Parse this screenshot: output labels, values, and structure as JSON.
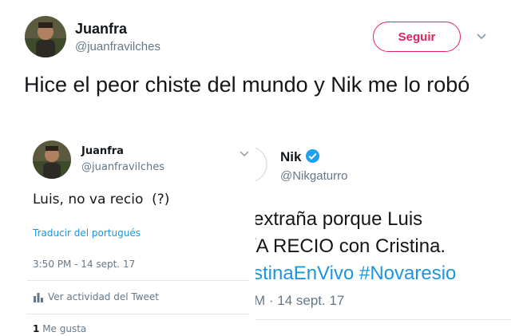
{
  "header": {
    "display_name": "Juanfra",
    "handle": "@juanfravilches",
    "follow_label": "Seguir",
    "menu_icon": "chevron-down-icon"
  },
  "tweet": {
    "text": "Hice el peor chiste del mundo y Nik me lo robó"
  },
  "left_card": {
    "display_name": "Juanfra",
    "handle": "@juanfravilches",
    "text": "Luis, no va recio  (?)",
    "translate_label": "Traducir del portugués",
    "timestamp": "3:50 PM - 14 sept. 17",
    "activity_label": "Ver actividad del Tweet",
    "likes_count": "1",
    "likes_label": "Me gusta"
  },
  "right_card": {
    "display_name": "Nik",
    "handle": "@Nikgaturro",
    "line1": "extraña porque Luis",
    "line2": "/A RECIO con Cristina.",
    "line3_part1": "stinaEnVivo",
    "line3_part2": "#Novaresio",
    "timestamp": "M · 14 sept. 17"
  },
  "colors": {
    "follow_accent": "#e0245e",
    "link": "#1b95e0",
    "muted_text": "#657786",
    "verified_badge": "#1da1f2"
  }
}
